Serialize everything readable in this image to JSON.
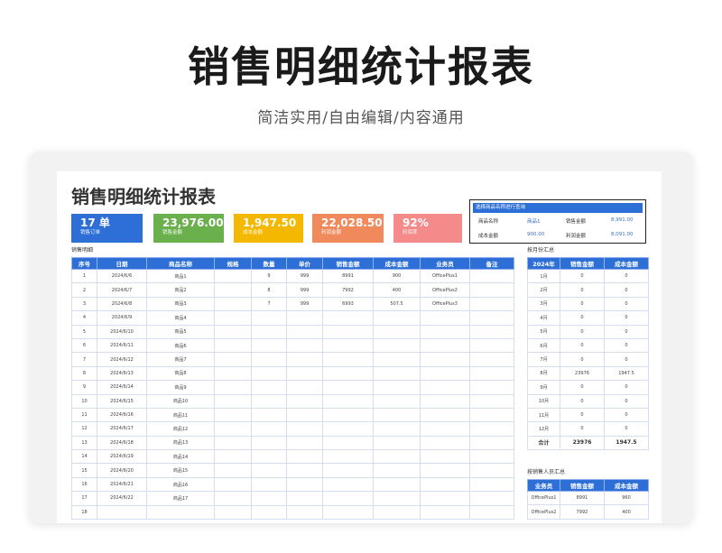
{
  "hero": {
    "title": "销售明细统计报表",
    "subtitle": "简洁实用/自由编辑/内容通用"
  },
  "sheet": {
    "title": "销售明细统计报表"
  },
  "kpis": [
    {
      "value": "17 单",
      "label": "销售订单",
      "color": "#2d6fd6"
    },
    {
      "value": "23,976.00",
      "label": "销售金额",
      "color": "#6ab04c"
    },
    {
      "value": "1,947.50",
      "label": "成本金额",
      "color": "#f5b800"
    },
    {
      "value": "22,028.50",
      "label": "利润金额",
      "color": "#f08a5d"
    },
    {
      "value": "92%",
      "label": "利润率",
      "color": "#f48a8a"
    }
  ],
  "lookup": {
    "header": "选择商品名称进行查询",
    "name_label": "商品名称",
    "name_value": "商品1",
    "sales_label": "销售金额",
    "sales_value": "8,991.00",
    "cost_label": "成本金额",
    "cost_value": "900.00",
    "profit_label": "利润金额",
    "profit_value": "8,091.00"
  },
  "main": {
    "section": "销售明细",
    "headers": [
      "序号",
      "日期",
      "商品名称",
      "规格",
      "数量",
      "单价",
      "销售金额",
      "成本金额",
      "业务员",
      "备注"
    ],
    "rows": [
      [
        "1",
        "2024/6/6",
        "商品1",
        "",
        "9",
        "999",
        "8991",
        "900",
        "OfficePlus1",
        ""
      ],
      [
        "2",
        "2024/6/7",
        "商品2",
        "",
        "8",
        "999",
        "7992",
        "400",
        "OfficePlus2",
        ""
      ],
      [
        "3",
        "2024/6/8",
        "商品3",
        "",
        "7",
        "999",
        "6993",
        "507.5",
        "OfficePlus3",
        ""
      ],
      [
        "4",
        "2024/6/9",
        "商品4",
        "",
        "",
        "",
        "",
        "",
        "",
        ""
      ],
      [
        "5",
        "2024/6/10",
        "商品5",
        "",
        "",
        "",
        "",
        "",
        "",
        ""
      ],
      [
        "6",
        "2024/6/11",
        "商品6",
        "",
        "",
        "",
        "",
        "",
        "",
        ""
      ],
      [
        "7",
        "2024/6/12",
        "商品7",
        "",
        "",
        "",
        "",
        "",
        "",
        ""
      ],
      [
        "8",
        "2024/6/13",
        "商品8",
        "",
        "",
        "",
        "",
        "",
        "",
        ""
      ],
      [
        "9",
        "2024/6/14",
        "商品9",
        "",
        "",
        "",
        "",
        "",
        "",
        ""
      ],
      [
        "10",
        "2024/6/15",
        "商品10",
        "",
        "",
        "",
        "",
        "",
        "",
        ""
      ],
      [
        "11",
        "2024/6/16",
        "商品11",
        "",
        "",
        "",
        "",
        "",
        "",
        ""
      ],
      [
        "12",
        "2024/6/17",
        "商品12",
        "",
        "",
        "",
        "",
        "",
        "",
        ""
      ],
      [
        "13",
        "2024/6/18",
        "商品13",
        "",
        "",
        "",
        "",
        "",
        "",
        ""
      ],
      [
        "14",
        "2024/6/19",
        "商品14",
        "",
        "",
        "",
        "",
        "",
        "",
        ""
      ],
      [
        "15",
        "2024/6/20",
        "商品15",
        "",
        "",
        "",
        "",
        "",
        "",
        ""
      ],
      [
        "16",
        "2024/6/21",
        "商品16",
        "",
        "",
        "",
        "",
        "",
        "",
        ""
      ],
      [
        "17",
        "2024/6/22",
        "商品17",
        "",
        "",
        "",
        "",
        "",
        "",
        ""
      ],
      [
        "18",
        "",
        "",
        "",
        "",
        "",
        "",
        "",
        "",
        ""
      ]
    ]
  },
  "monthly": {
    "section": "按月份汇总",
    "headers": [
      "2024年",
      "销售金额",
      "成本金额"
    ],
    "rows": [
      [
        "1月",
        "0",
        "0"
      ],
      [
        "2月",
        "0",
        "0"
      ],
      [
        "3月",
        "0",
        "0"
      ],
      [
        "4月",
        "0",
        "0"
      ],
      [
        "5月",
        "0",
        "0"
      ],
      [
        "6月",
        "0",
        "0"
      ],
      [
        "7月",
        "0",
        "0"
      ],
      [
        "8月",
        "23976",
        "1947.5"
      ],
      [
        "9月",
        "0",
        "0"
      ],
      [
        "10月",
        "0",
        "0"
      ],
      [
        "11月",
        "0",
        "0"
      ],
      [
        "12月",
        "0",
        "0"
      ]
    ],
    "total": [
      "合计",
      "23976",
      "1947.5"
    ]
  },
  "staff": {
    "section": "按销售人员汇总",
    "headers": [
      "业务员",
      "销售金额",
      "成本金额"
    ],
    "rows": [
      [
        "OfficePlus1",
        "8991",
        "960"
      ],
      [
        "OfficePlus2",
        "7992",
        "400"
      ]
    ]
  }
}
